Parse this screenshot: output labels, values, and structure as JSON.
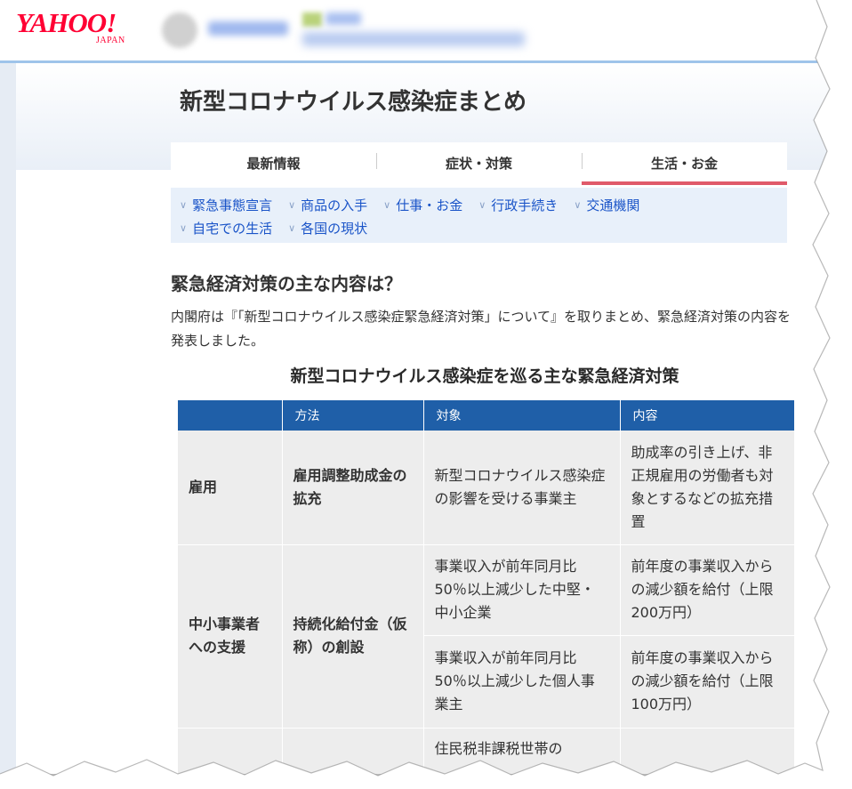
{
  "logo": {
    "main": "YAHOO!",
    "sub": "JAPAN"
  },
  "page": {
    "title": "新型コロナウイルス感染症まとめ"
  },
  "tabs": [
    {
      "label": "最新情報"
    },
    {
      "label": "症状・対策"
    },
    {
      "label": "生活・お金"
    }
  ],
  "active_tab": "生活・お金",
  "subnav": {
    "row1": [
      "緊急事態宣言",
      "商品の入手",
      "仕事・お金",
      "行政手続き",
      "交通機関"
    ],
    "row2": [
      "自宅での生活",
      "各国の現状"
    ]
  },
  "article": {
    "heading": "緊急経済対策の主な内容は？",
    "intro": "内閣府は『「新型コロナウイルス感染症緊急経済対策」について』を取りまとめ、緊急経済対策の内容を発表しました。"
  },
  "table": {
    "title": "新型コロナウイルス感染症を巡る主な緊急経済対策",
    "headers": [
      "",
      "方法",
      "対象",
      "内容"
    ],
    "rows": [
      {
        "category": "雇用",
        "method": "雇用調整助成金の拡充",
        "target": "新型コロナウイルス感染症の影響を受ける事業主",
        "content": "助成率の引き上げ、非正規雇用の労働者も対象とするなどの拡充措置"
      },
      {
        "category": "中小事業者への支援",
        "method": "持続化給付金（仮称）の創設",
        "target": "事業収入が前年同月比50％以上減少した中堅・中小企業",
        "content": "前年度の事業収入からの減少額を給付（上限200万円）"
      },
      {
        "target": "事業収入が前年同月比50％以上減少した個人事業主",
        "content": "前年度の事業収入からの減少額を給付（上限100万円）"
      },
      {
        "target": "住民税非課税世帯の"
      }
    ]
  }
}
